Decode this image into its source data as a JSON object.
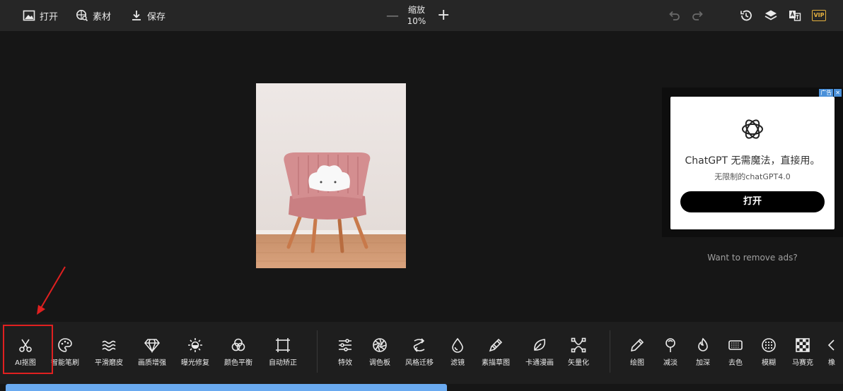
{
  "topbar": {
    "open_label": "打开",
    "assets_label": "素材",
    "save_label": "保存",
    "zoom_label": "缩放",
    "zoom_value": "10%",
    "vip_label": "VIP"
  },
  "ad": {
    "tags": [
      "广告",
      "✕"
    ],
    "title": "ChatGPT 无需魔法，直接用。",
    "subtitle": "无限制的chatGPT4.0",
    "button_label": "打开",
    "remove_label": "Want to remove ads?"
  },
  "tools": [
    {
      "label": "AI抠图",
      "icon": "scissors-icon"
    },
    {
      "label": "智能笔刷",
      "icon": "palette-icon"
    },
    {
      "label": "平滑磨皮",
      "icon": "waves-icon"
    },
    {
      "label": "画质增强",
      "icon": "diamond-icon"
    },
    {
      "label": "曝光修复",
      "icon": "sun-icon"
    },
    {
      "label": "颜色平衡",
      "icon": "color-circles-icon"
    },
    {
      "label": "自动矫正",
      "icon": "crop-frame-icon"
    },
    {
      "label": "特效",
      "icon": "sliders-icon"
    },
    {
      "label": "调色板",
      "icon": "aperture-icon"
    },
    {
      "label": "风格迁移",
      "icon": "style-transfer-icon"
    },
    {
      "label": "滤镜",
      "icon": "drop-icon"
    },
    {
      "label": "素描草图",
      "icon": "pencil-sketch-icon"
    },
    {
      "label": "卡通漫画",
      "icon": "leaf-icon"
    },
    {
      "label": "矢量化",
      "icon": "vector-nodes-icon"
    },
    {
      "label": "绘图",
      "icon": "pencil-icon"
    },
    {
      "label": "减淡",
      "icon": "dodge-icon"
    },
    {
      "label": "加深",
      "icon": "flame-icon"
    },
    {
      "label": "去色",
      "icon": "desaturate-icon"
    },
    {
      "label": "模糊",
      "icon": "blur-icon"
    },
    {
      "label": "马赛克",
      "icon": "mosaic-icon"
    },
    {
      "label": "橡",
      "icon": "chevron-left-icon"
    }
  ],
  "colors": {
    "accent_highlight": "#e02020",
    "vip": "#e5b13f",
    "progress": "#6aaaf0"
  }
}
